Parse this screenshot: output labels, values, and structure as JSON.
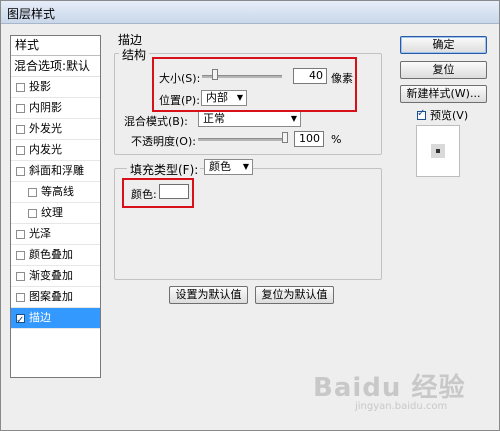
{
  "window": {
    "title": "图层样式"
  },
  "style_list": {
    "header": "样式",
    "blend_options": "混合选项:默认",
    "items": [
      {
        "label": "投影",
        "checked": false,
        "sub": false
      },
      {
        "label": "内阴影",
        "checked": false,
        "sub": false
      },
      {
        "label": "外发光",
        "checked": false,
        "sub": false
      },
      {
        "label": "内发光",
        "checked": false,
        "sub": false
      },
      {
        "label": "斜面和浮雕",
        "checked": false,
        "sub": false
      },
      {
        "label": "等高线",
        "checked": false,
        "sub": true
      },
      {
        "label": "纹理",
        "checked": false,
        "sub": true
      },
      {
        "label": "光泽",
        "checked": false,
        "sub": false
      },
      {
        "label": "颜色叠加",
        "checked": false,
        "sub": false
      },
      {
        "label": "渐变叠加",
        "checked": false,
        "sub": false
      },
      {
        "label": "图案叠加",
        "checked": false,
        "sub": false
      },
      {
        "label": "描边",
        "checked": true,
        "sub": false,
        "selected": true
      }
    ]
  },
  "stroke": {
    "section_title": "描边",
    "structure_title": "结构",
    "size_label": "大小(S):",
    "size_value": "40",
    "size_unit": "像素",
    "size_slider_fraction": 0.16,
    "position_label": "位置(P):",
    "position_value": "内部",
    "blend_mode_label": "混合模式(B):",
    "blend_mode_value": "正常",
    "opacity_label": "不透明度(O):",
    "opacity_value": "100",
    "opacity_unit": "%",
    "opacity_slider_fraction": 1.0,
    "fill_type_label": "填充类型(F):",
    "fill_type_value": "颜色",
    "color_label": "颜色:",
    "color_value": "#ffffff",
    "set_default_button": "设置为默认值",
    "reset_default_button": "复位为默认值"
  },
  "buttons": {
    "ok": "确定",
    "reset": "复位",
    "new_style": "新建样式(W)...",
    "preview_label": "预览(V)",
    "preview_checked": true
  },
  "watermark": {
    "brand": "Baidu 经验",
    "url": "jingyan.baidu.com"
  },
  "colors": {
    "highlight": "#d8101a",
    "selection": "#3399ff"
  }
}
